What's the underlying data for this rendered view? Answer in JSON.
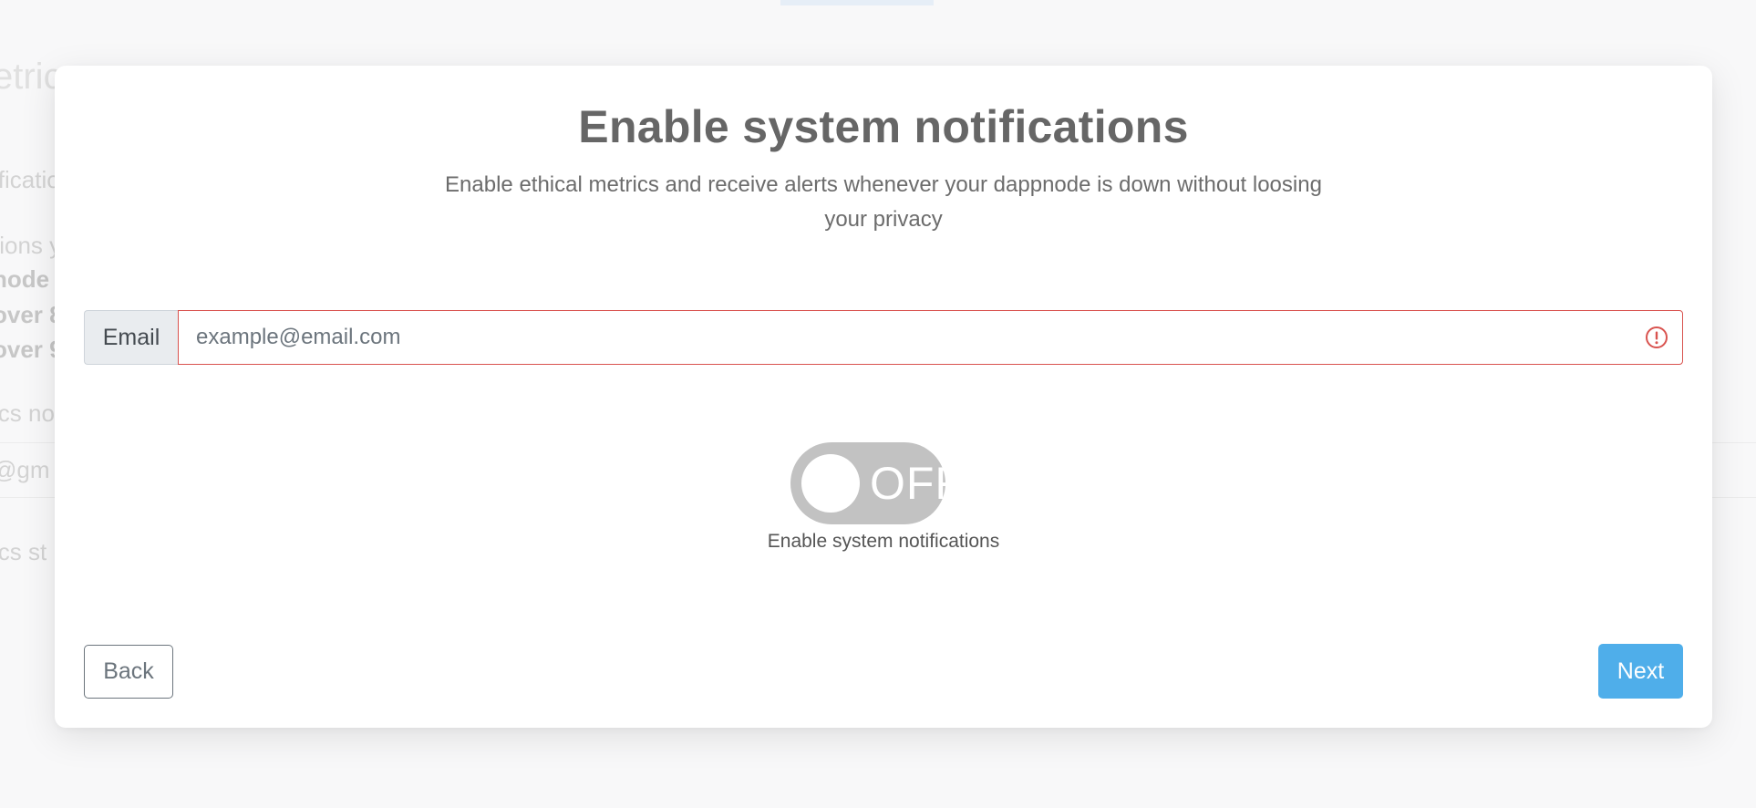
{
  "background": {
    "title_fragment": "etric",
    "lines": [
      {
        "text": "ificatio",
        "bold": false
      },
      {
        "text": "tions y",
        "bold": false
      },
      {
        "text": "node",
        "bold": true
      },
      {
        "text": "over 8",
        "bold": true
      },
      {
        "text": "over 9",
        "bold": true
      },
      {
        "text": "ics no",
        "bold": false
      },
      {
        "text": "@gm",
        "bold": false
      },
      {
        "text": "ics st",
        "bold": false
      }
    ]
  },
  "modal": {
    "title": "Enable system notifications",
    "subtitle": "Enable ethical metrics and receive alerts whenever your dappnode is down without loosing your privacy",
    "email": {
      "label": "Email",
      "value": "",
      "placeholder": "example@email.com",
      "invalid": true,
      "icon": "exclamation-circle-icon"
    },
    "toggle": {
      "state_text": "OFF",
      "checked": false,
      "label": "Enable system notifications"
    },
    "buttons": {
      "back": "Back",
      "next": "Next"
    }
  },
  "colors": {
    "primary": "#4faeea",
    "invalid": "#d9534f",
    "toggle_off": "#c2c2c2",
    "title": "#666666"
  }
}
